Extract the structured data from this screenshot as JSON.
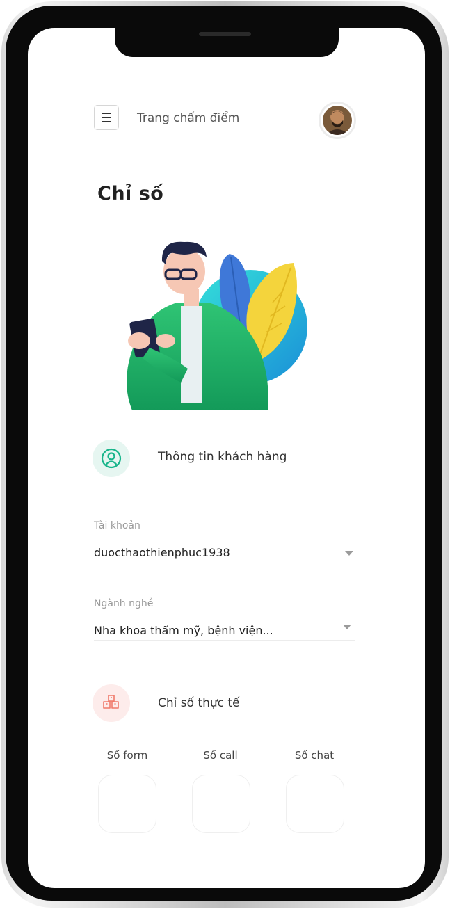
{
  "header": {
    "title": "Trang chấm điểm"
  },
  "page": {
    "title": "Chỉ số"
  },
  "customer_section": {
    "label": "Thông tin khách hàng"
  },
  "account_field": {
    "label": "Tài khoản",
    "value": "duocthaothienphuc1938"
  },
  "industry_field": {
    "label": "Ngành nghề",
    "value": "Nha khoa thẩm mỹ, bệnh viện..."
  },
  "metrics_section": {
    "label": "Chỉ số thực tế"
  },
  "metrics": [
    {
      "label": "Số form"
    },
    {
      "label": "Số call"
    },
    {
      "label": "Số chat"
    }
  ],
  "icons": {
    "menu": "hamburger-icon",
    "customer": "user-circle-icon",
    "metrics": "boxes-icon",
    "dropdown": "caret-down-icon"
  },
  "colors": {
    "customer_icon": "#18b58b",
    "customer_icon_bg": "#e6f6f1",
    "metrics_icon": "#f07a6a",
    "metrics_icon_bg": "#fdeceb"
  }
}
